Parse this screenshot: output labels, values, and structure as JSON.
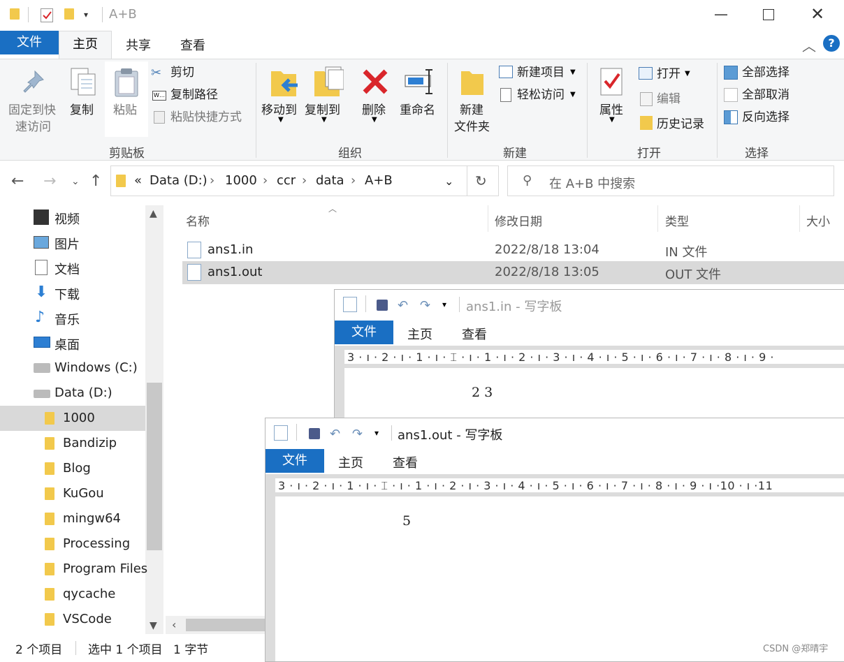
{
  "explorer": {
    "title": "A+B",
    "tabs": {
      "file": "文件",
      "home": "主页",
      "share": "共享",
      "view": "查看"
    },
    "ribbon": {
      "pin": "固定到快\n速访问",
      "pin_line1": "固定到快",
      "pin_line2": "速访问",
      "copy": "复制",
      "paste": "粘贴",
      "cut": "剪切",
      "copy_path": "复制路径",
      "paste_shortcut": "粘贴快捷方式",
      "group_clipboard": "剪贴板",
      "move_to": "移动到",
      "copy_to": "复制到",
      "delete": "删除",
      "rename": "重命名",
      "group_organize": "组织",
      "new_folder_line1": "新建",
      "new_folder_line2": "文件夹",
      "new_item": "新建项目",
      "easy_access": "轻松访问",
      "group_new": "新建",
      "properties": "属性",
      "open": "打开",
      "edit": "编辑",
      "history": "历史记录",
      "group_open": "打开",
      "select_all": "全部选择",
      "select_none": "全部取消",
      "invert_select": "反向选择",
      "group_select": "选择"
    },
    "address": {
      "chevron": "«",
      "crumbs": [
        "Data (D:)",
        "1000",
        "ccr",
        "data",
        "A+B"
      ],
      "search_placeholder": "在 A+B 中搜索"
    },
    "sidebar": {
      "items": [
        "视频",
        "图片",
        "文档",
        "下载",
        "音乐",
        "桌面",
        "Windows (C:)",
        "Data (D:)",
        "1000",
        "Bandizip",
        "Blog",
        "KuGou",
        "mingw64",
        "Processing",
        "Program Files",
        "qycache",
        "VSCode"
      ]
    },
    "columns": {
      "name": "名称",
      "modified": "修改日期",
      "type": "类型",
      "size": "大小"
    },
    "files": [
      {
        "name": "ans1.in",
        "modified": "2022/8/18 13:04",
        "type": "IN 文件"
      },
      {
        "name": "ans1.out",
        "modified": "2022/8/18 13:05",
        "type": "OUT 文件"
      }
    ],
    "status": {
      "count": "2 个项目",
      "selected": "选中 1 个项目",
      "size": "1 字节"
    }
  },
  "wordpad1": {
    "title": "ans1.in - 写字板",
    "tabs": {
      "file": "文件",
      "home": "主页",
      "view": "查看"
    },
    "ruler": "3 · ı · 2 · ı · 1 · ı · ⌶ · ı · 1 · ı · 2 · ı · 3 · ı · 4 · ı · 5 · ı · 6 · ı · 7 · ı · 8 · ı · 9 ·",
    "content": "2 3"
  },
  "wordpad2": {
    "title": "ans1.out - 写字板",
    "tabs": {
      "file": "文件",
      "home": "主页",
      "view": "查看"
    },
    "ruler": "3 · ı · 2 · ı · 1 · ı · ⌶ · ı · 1 · ı · 2 · ı · 3 · ı · 4 · ı · 5 · ı · 6 · ı · 7 · ı · 8 · ı · 9 · ı ·10 · ı ·11",
    "content": "5"
  },
  "watermark": "CSDN @郑晴宇",
  "colors": {
    "accent": "#1a6fc3",
    "selected_row": "#d9d9d9",
    "folder": "#f2c94c",
    "delete_red": "#d9262b"
  }
}
